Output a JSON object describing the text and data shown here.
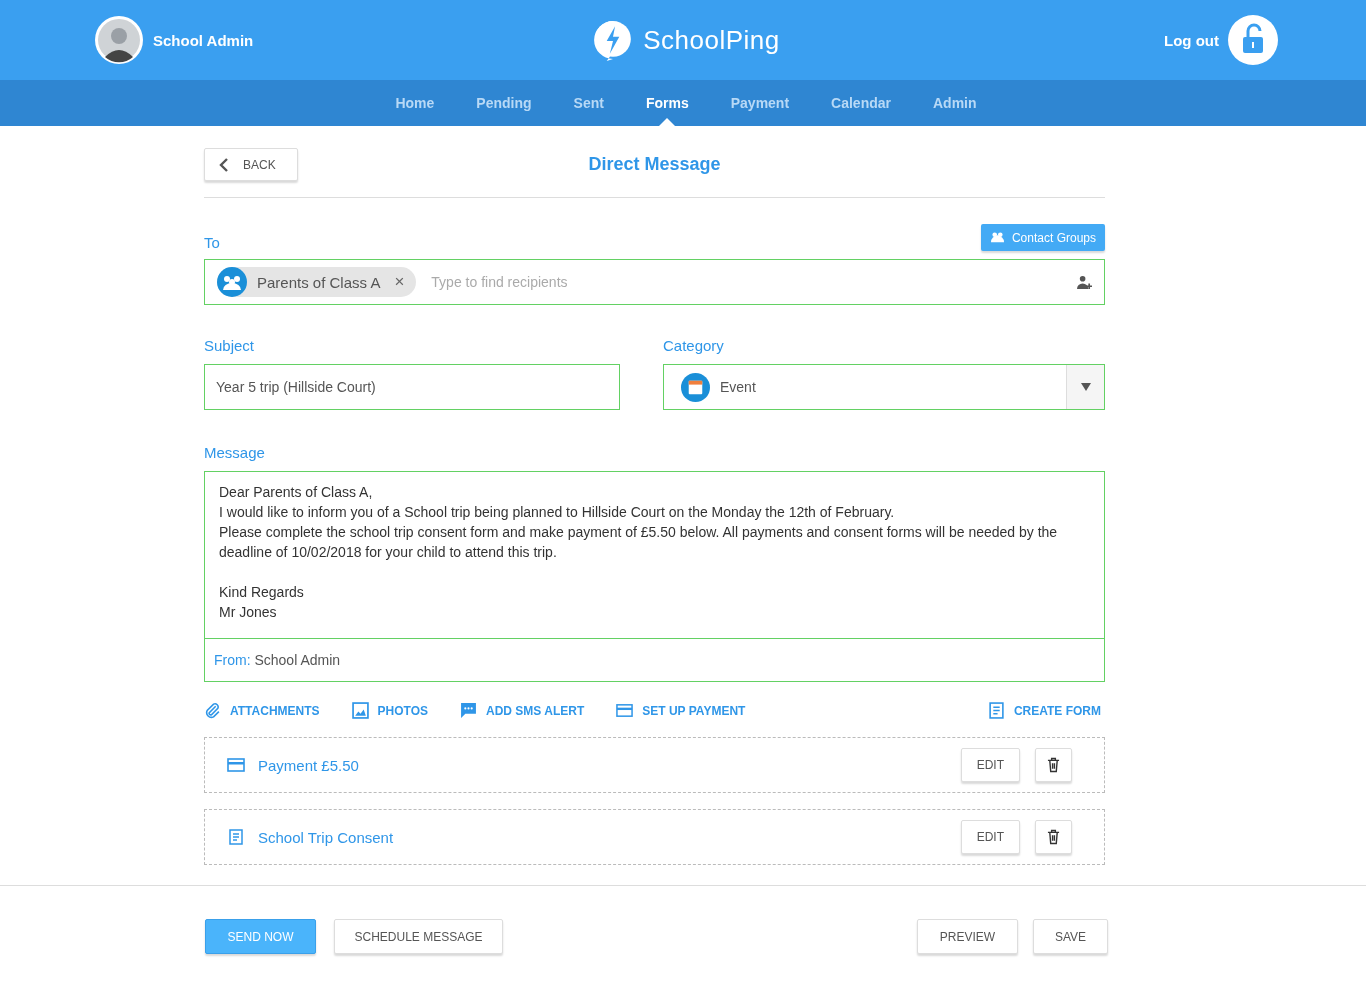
{
  "header": {
    "user": "School Admin",
    "brand": "SchoolPing",
    "logout": "Log out"
  },
  "nav": [
    {
      "label": "Home",
      "selected": false
    },
    {
      "label": "Pending",
      "selected": false
    },
    {
      "label": "Sent",
      "selected": false
    },
    {
      "label": "Forms",
      "selected": true
    },
    {
      "label": "Payment",
      "selected": false
    },
    {
      "label": "Calendar",
      "selected": false
    },
    {
      "label": "Admin",
      "selected": false
    }
  ],
  "back": "BACK",
  "title": "Direct Message",
  "to": {
    "label": "To",
    "contact_groups": "Contact Groups",
    "chip": "Parents of Class A",
    "chip_remove": "×",
    "placeholder": "Type to find recipients"
  },
  "subject": {
    "label": "Subject",
    "value": "Year 5 trip (Hillside Court)"
  },
  "category": {
    "label": "Category",
    "value": "Event"
  },
  "message": {
    "label": "Message",
    "body": "Dear Parents of Class A,\nI would like to inform you of a School trip being planned to Hillside Court on the Monday the 12th of February.\nPlease complete the school trip consent form and make payment of £5.50 below. All payments and consent forms will be needed by the deadline of 10/02/2018 for your child to attend this trip.\n\nKind Regards\nMr Jones",
    "from_label": "From:",
    "from_value": "School Admin"
  },
  "actions": [
    {
      "kind": "clip",
      "label": "ATTACHMENTS"
    },
    {
      "kind": "photo",
      "label": "PHOTOS"
    },
    {
      "kind": "sms",
      "label": "ADD SMS ALERT"
    },
    {
      "kind": "card",
      "label": "SET UP PAYMENT"
    }
  ],
  "create_form": {
    "kind": "doc",
    "label": "CREATE FORM"
  },
  "attachments": [
    {
      "kind": "card",
      "label": "Payment £5.50",
      "edit": "EDIT"
    },
    {
      "kind": "doc",
      "label": "School Trip Consent",
      "edit": "EDIT"
    }
  ],
  "footer": {
    "send": "SEND NOW",
    "schedule": "SCHEDULE MESSAGE",
    "preview": "PREVIEW",
    "save": "SAVE"
  }
}
